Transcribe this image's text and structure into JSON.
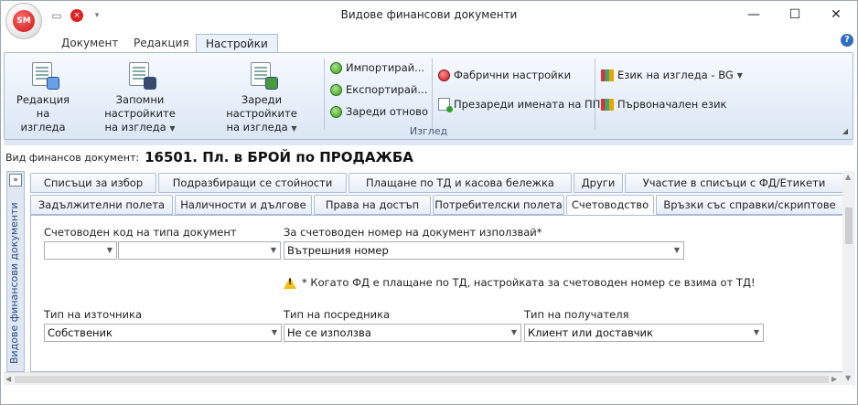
{
  "window": {
    "title": "Видове финансови документи",
    "logo_text": "SM"
  },
  "ribbon_tabs": [
    {
      "label": "Документ"
    },
    {
      "label": "Редакция"
    },
    {
      "label": "Настройки"
    }
  ],
  "ribbon": {
    "buttons": {
      "edit_view": [
        "Редакция",
        "на изгледа"
      ],
      "save_settings": [
        "Запомни настройките",
        "на изгледа"
      ],
      "load_settings": [
        "Зареди настройките",
        "на изгледа"
      ],
      "import": "Импортирай...",
      "export": "Експортирай...",
      "reload": "Зареди отново",
      "factory": "Фабрични настройки",
      "reload_names": "Презареди имената на ПП",
      "language": "Език на изгледа - BG",
      "initial_language": "Първоначален език"
    },
    "group_label": "Изглед"
  },
  "doc_type": {
    "label": "Вид финансов документ:",
    "value": "16501. Пл. в БРОЙ по ПРОДАЖБА"
  },
  "side_panel": {
    "toggle": "»",
    "label": "Видове финансови документи"
  },
  "tabs_row1": [
    "Списъци за избор",
    "Подразбиращи се стойности",
    "Плащане по ТД и касова бележка",
    "Други",
    "Участие в списъци с ФД/Етикети"
  ],
  "tabs_row2": [
    "Задължителни полета",
    "Наличности и дългове",
    "Права на достъп",
    "Потребителски полета",
    "Счетоводство",
    "Връзки със справки/скриптове"
  ],
  "form": {
    "acc_code_label": "Счетоводен код на типа документ",
    "acc_code_value1": "",
    "acc_code_value2": "",
    "acc_number_label": "За счетоводен номер на документ използвай*",
    "acc_number_value": "Вътрешния номер",
    "warning": "* Когато ФД е плащане по ТД, настройката за счетоводен номер се взима от ТД!",
    "source_label": "Тип на източника",
    "source_value": "Собственик",
    "mediator_label": "Тип на посредника",
    "mediator_value": "Не се използва",
    "receiver_label": "Тип на получателя",
    "receiver_value": "Клиент или доставчик"
  }
}
